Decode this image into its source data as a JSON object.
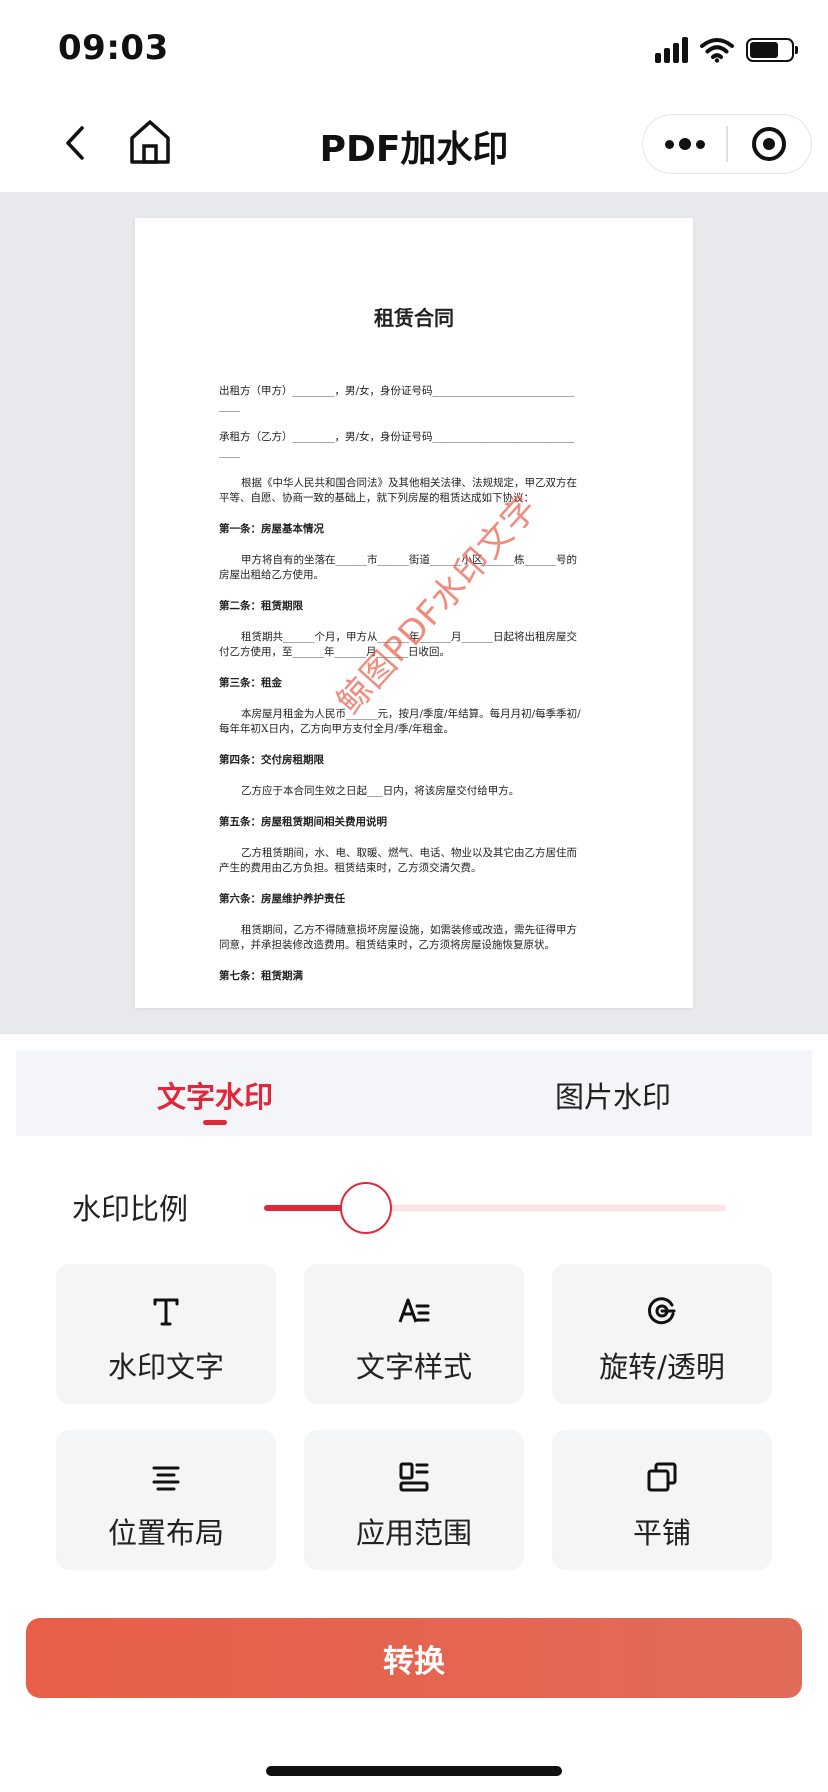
{
  "status_bar": {
    "time": "09:03"
  },
  "nav": {
    "title": "PDF加水印"
  },
  "document": {
    "title": "租赁合同",
    "lines": [
      {
        "text": "出租方（甲方）________，男/女，身份证号码___________________________",
        "cls": "doc-line"
      },
      {
        "text": "____",
        "cls": "doc-line doc-para"
      },
      {
        "text": "承租方（乙方）________，男/女，身份证号码___________________________",
        "cls": "doc-line"
      },
      {
        "text": "____",
        "cls": "doc-line doc-para"
      },
      {
        "text": "根据《中华人民共和国合同法》及其他相关法律、法规规定，甲乙双方在",
        "cls": "doc-line doc-indent"
      },
      {
        "text": "平等、自愿、协商一致的基础上，就下列房屋的租赁达成如下协议：",
        "cls": "doc-line doc-para"
      },
      {
        "text": "第一条：房屋基本情况",
        "cls": "doc-line doc-heading"
      },
      {
        "text": "甲方将自有的坐落在______市______街道______小区______栋______号的",
        "cls": "doc-line doc-indent"
      },
      {
        "text": "房屋出租给乙方使用。",
        "cls": "doc-line doc-para"
      },
      {
        "text": "第二条：租赁期限",
        "cls": "doc-line doc-heading"
      },
      {
        "text": "租赁期共______个月，甲方从______年______月______日起将出租房屋交",
        "cls": "doc-line doc-indent"
      },
      {
        "text": "付乙方使用，至______年______月______日收回。",
        "cls": "doc-line doc-para"
      },
      {
        "text": "第三条：租金",
        "cls": "doc-line doc-heading"
      },
      {
        "text": "本房屋月租金为人民币______元，按月/季度/年结算。每月月初/每季季初/",
        "cls": "doc-line doc-indent"
      },
      {
        "text": "每年年初X日内，乙方向甲方支付全月/季/年租金。",
        "cls": "doc-line doc-para"
      },
      {
        "text": "第四条：交付房租期限",
        "cls": "doc-line doc-heading"
      },
      {
        "text": "乙方应于本合同生效之日起___日内，将该房屋交付给甲方。",
        "cls": "doc-line doc-indent doc-para"
      },
      {
        "text": "第五条：房屋租赁期间相关费用说明",
        "cls": "doc-line doc-heading"
      },
      {
        "text": "乙方租赁期间，水、电、取暖、燃气、电话、物业以及其它由乙方居住而",
        "cls": "doc-line doc-indent"
      },
      {
        "text": "产生的费用由乙方负担。租赁结束时，乙方须交清欠费。",
        "cls": "doc-line doc-para"
      },
      {
        "text": "第六条：房屋维护养护责任",
        "cls": "doc-line doc-heading"
      },
      {
        "text": "租赁期间，乙方不得随意损坏房屋设施，如需装修或改造，需先征得甲方",
        "cls": "doc-line doc-indent"
      },
      {
        "text": "同意，并承担装修改造费用。租赁结束时，乙方须将房屋设施恢复原状。",
        "cls": "doc-line doc-para"
      },
      {
        "text": "第七条：租赁期满",
        "cls": "doc-line doc-heading"
      }
    ],
    "watermark_text": "鲸图PDF水印文字"
  },
  "tabs": [
    {
      "label": "文字水印",
      "active": true
    },
    {
      "label": "图片水印",
      "active": false
    }
  ],
  "slider": {
    "label": "水印比例",
    "value": 0.22
  },
  "options": [
    {
      "label": "水印文字",
      "icon": "text-t-icon"
    },
    {
      "label": "文字样式",
      "icon": "text-style-icon"
    },
    {
      "label": "旋转/透明",
      "icon": "rotate-icon"
    },
    {
      "label": "位置布局",
      "icon": "align-center-icon"
    },
    {
      "label": "应用范围",
      "icon": "layout-grid-icon"
    },
    {
      "label": "平铺",
      "icon": "tile-copy-icon"
    }
  ],
  "convert_button": {
    "label": "转换"
  },
  "colors": {
    "accent": "#e0283a",
    "button": "#e6604c",
    "preview_bg": "#e8e9ec"
  }
}
